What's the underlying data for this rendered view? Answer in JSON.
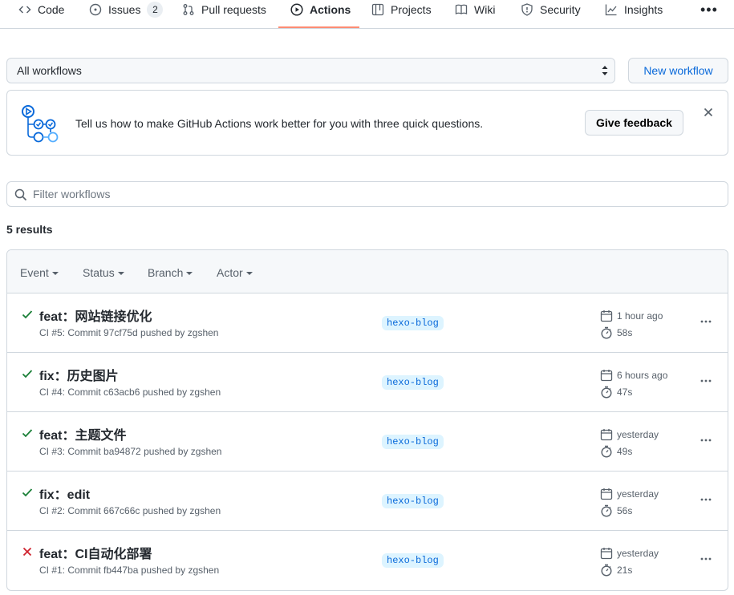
{
  "nav": {
    "tabs": [
      {
        "label": "Code",
        "icon": "code-icon"
      },
      {
        "label": "Issues",
        "icon": "issue-opened-icon",
        "count": "2"
      },
      {
        "label": "Pull requests",
        "icon": "git-pull-request-icon"
      },
      {
        "label": "Actions",
        "icon": "play-icon",
        "selected": true
      },
      {
        "label": "Projects",
        "icon": "table-icon"
      },
      {
        "label": "Wiki",
        "icon": "book-icon"
      },
      {
        "label": "Security",
        "icon": "shield-icon"
      },
      {
        "label": "Insights",
        "icon": "graph-icon"
      }
    ],
    "more": "•••"
  },
  "workflow_select": {
    "value": "All workflows"
  },
  "new_workflow_label": "New workflow",
  "banner": {
    "message": "Tell us how to make GitHub Actions work better for you with three quick questions.",
    "button_label": "Give feedback"
  },
  "filter": {
    "placeholder": "Filter workflows"
  },
  "results_label": "5 results",
  "filters": {
    "event": "Event",
    "status": "Status",
    "branch": "Branch",
    "actor": "Actor"
  },
  "runs": [
    {
      "status": "success",
      "title": "feat：网站链接优化",
      "meta": "CI #5: Commit 97cf75d pushed by zgshen",
      "branch": "hexo-blog",
      "when": "1 hour ago",
      "duration": "58s"
    },
    {
      "status": "success",
      "title": "fix：历史图片",
      "meta": "CI #4: Commit c63acb6 pushed by zgshen",
      "branch": "hexo-blog",
      "when": "6 hours ago",
      "duration": "47s"
    },
    {
      "status": "success",
      "title": "feat：主题文件",
      "meta": "CI #3: Commit ba94872 pushed by zgshen",
      "branch": "hexo-blog",
      "when": "yesterday",
      "duration": "49s"
    },
    {
      "status": "success",
      "title": "fix：edit",
      "meta": "CI #2: Commit 667c66c pushed by zgshen",
      "branch": "hexo-blog",
      "when": "yesterday",
      "duration": "56s"
    },
    {
      "status": "failure",
      "title": "feat：CI自动化部署",
      "meta": "CI #1: Commit fb447ba pushed by zgshen",
      "branch": "hexo-blog",
      "when": "yesterday",
      "duration": "21s"
    }
  ],
  "colors": {
    "success": "#1a7f37",
    "failure": "#cf222e",
    "accent": "#fd8c73",
    "link": "#0969da"
  }
}
